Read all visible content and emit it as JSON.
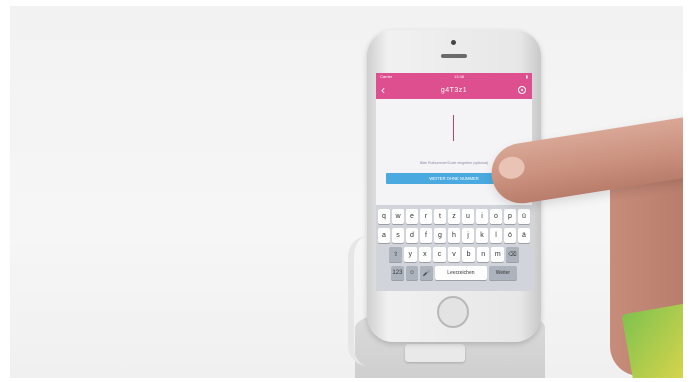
{
  "phone": {
    "status_left": "Carrier",
    "status_time": "13:38",
    "app_title": "g4T3z1",
    "back_icon": "chevron-left-icon",
    "eye_icon": "eye-icon",
    "hint_text": "Bitte Rufnummer/Code eingeben (optional)",
    "continue_label": "WEITER OHNE NUMMER",
    "keyboard": {
      "row1": [
        "q",
        "w",
        "e",
        "r",
        "t",
        "z",
        "u",
        "i",
        "o",
        "p",
        "ü"
      ],
      "row2": [
        "a",
        "s",
        "d",
        "f",
        "g",
        "h",
        "j",
        "k",
        "l",
        "ö",
        "ä"
      ],
      "row3_shift": "⇧",
      "row3": [
        "y",
        "x",
        "c",
        "v",
        "b",
        "n",
        "m"
      ],
      "row3_delete": "⌫",
      "bottom": {
        "numbers": "123",
        "emoji": "☺",
        "mic": "🎤",
        "space": "Leerzeichen",
        "send": "Weiter"
      }
    }
  },
  "colors": {
    "app_bar": "#dd4f8f",
    "button": "#4aa9de"
  }
}
